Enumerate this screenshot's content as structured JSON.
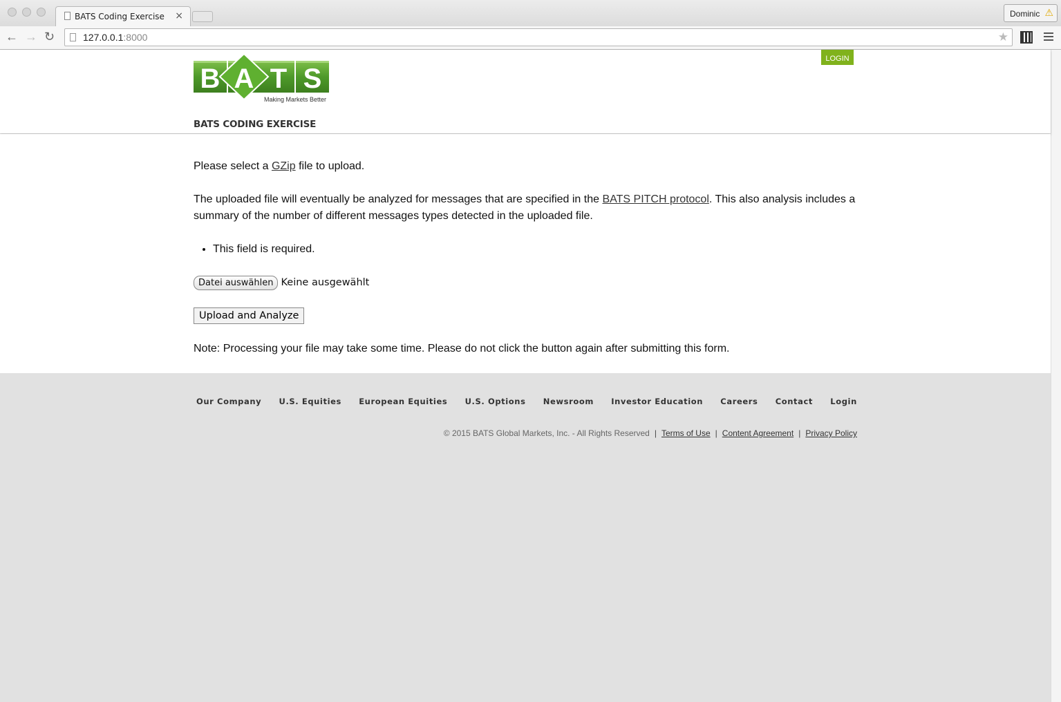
{
  "browser": {
    "tab_title": "BATS Coding Exercise",
    "tab_close": "×",
    "profile_name": "Dominic",
    "url_host": "127.0.0.1",
    "url_port": ":8000"
  },
  "header": {
    "logo_letters": [
      "B",
      "A",
      "T",
      "S"
    ],
    "logo_tagline": "Making Markets Better",
    "login_label": "LOGIN",
    "site_title": "BATS CODING EXERCISE"
  },
  "main": {
    "intro_prefix": "Please select a ",
    "intro_link": "GZip",
    "intro_suffix": " file to upload.",
    "desc_prefix": "The uploaded file will eventually be analyzed for messages that are specified in the ",
    "desc_link": "BATS PITCH protocol",
    "desc_suffix": ". This also analysis includes a summary of the number of different messages types detected in the uploaded file.",
    "errors": [
      "This field is required."
    ],
    "file_button": "Datei auswählen",
    "file_status": "Keine ausgewählt",
    "submit_label": "Upload and Analyze",
    "note": "Note: Processing your file may take some time. Please do not click the button again after submitting this form."
  },
  "footer": {
    "nav": [
      "Our Company",
      "U.S. Equities",
      "European Equities",
      "U.S. Options",
      "Newsroom",
      "Investor Education",
      "Careers",
      "Contact",
      "Login"
    ],
    "copyright": "© 2015 BATS Global Markets, Inc. - All Rights Reserved",
    "links": {
      "terms": "Terms of Use",
      "content": "Content Agreement",
      "privacy": "Privacy Policy"
    }
  },
  "colors": {
    "brand_green": "#80b21c",
    "logo_green": "#4f9a2b"
  }
}
